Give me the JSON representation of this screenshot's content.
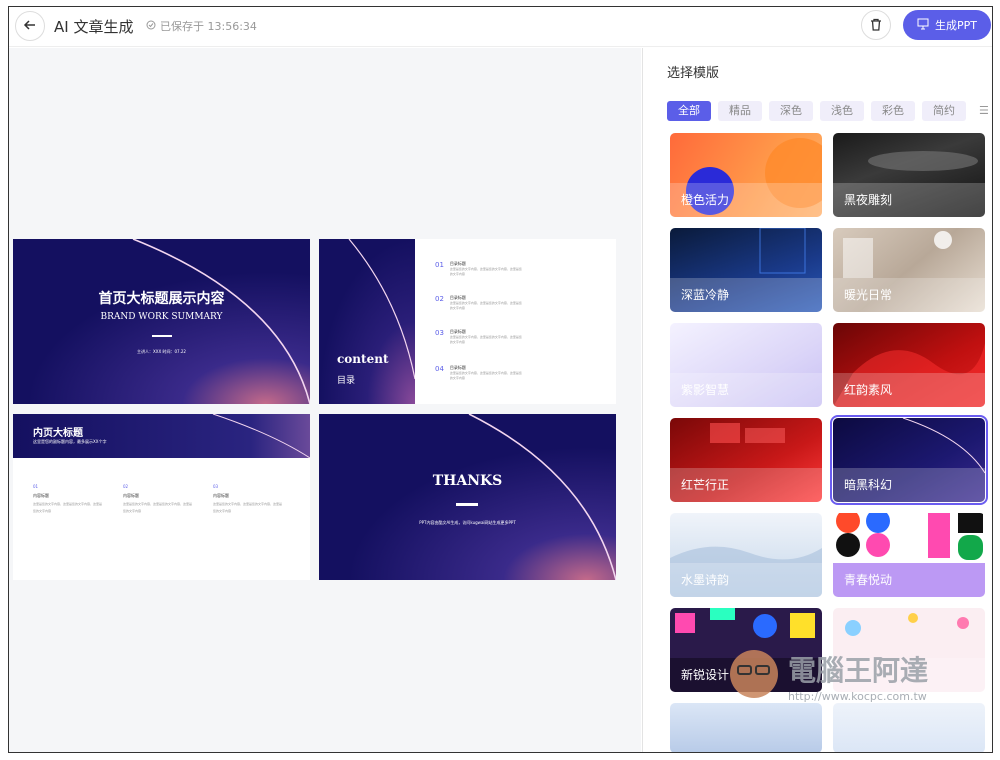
{
  "header": {
    "title": "AI 文章生成",
    "saved": "已保存于 13:56:34",
    "generate_label": "生成PPT"
  },
  "icons": {
    "back": "arrow-left-icon",
    "saved": "check-circle-icon",
    "trash": "trash-icon",
    "generate": "presentation-icon"
  },
  "colors": {
    "accent": "#5b5ee8",
    "slide_bg": "#14125a"
  },
  "panel": {
    "title": "选择模版",
    "chips": [
      "全部",
      "精品",
      "深色",
      "浅色",
      "彩色",
      "简约"
    ],
    "templates": [
      "橙色活力",
      "黑夜雕刻",
      "深蓝冷静",
      "暖光日常",
      "紫影智慧",
      "红韵素风",
      "红芒行正",
      "暗黑科幻",
      "水墨诗韵",
      "青春悦动",
      "新锐设计",
      "",
      ""
    ]
  },
  "slides": {
    "cover": {
      "title": "首页大标题展示内容",
      "subtitle": "BRAND WORK SUMMARY",
      "meta": "主讲人：XXX 时间：07.22"
    },
    "toc": {
      "title": "content",
      "subtitle": "目录",
      "items": [
        {
          "n": "01",
          "t": "目录标题",
          "l1": "这里是您的文字内容，这里是您的文字内容，这里是您",
          "l2": "的文字内容"
        },
        {
          "n": "02",
          "t": "目录标题",
          "l1": "这里是您的文字内容，这里是您的文字内容，这里是您",
          "l2": "的文字内容"
        },
        {
          "n": "03",
          "t": "目录标题",
          "l1": "这里是您的文字内容，这里是您的文字内容，这里是您",
          "l2": "的文字内容"
        },
        {
          "n": "04",
          "t": "目录标题",
          "l1": "这里是您的文字内容，这里是您的文字内容，这里是您",
          "l2": "的文字内容"
        }
      ]
    },
    "inner": {
      "title": "内页大标题",
      "subtitle": "这里是您的副标题内容，最多展示XX个字",
      "cols": [
        {
          "n": "01",
          "t": "内容标题",
          "body": "这里是您的文字内容，这里是您的文字内容，这里是您的文字内容"
        },
        {
          "n": "02",
          "t": "内容标题",
          "body": "这里是您的文字内容，这里是您的文字内容，这里是您的文字内容"
        },
        {
          "n": "03",
          "t": "内容标题",
          "body": "这里是您的文字内容，这里是您的文字内容，这里是您的文字内容"
        }
      ]
    },
    "end": {
      "title": "THANKS",
      "subtitle": "PPT内容由酷文AI生成，访问kugwai网站生成更多PPT"
    }
  },
  "watermark": {
    "text": "電腦王阿達",
    "url": "http://www.kocpc.com.tw"
  }
}
